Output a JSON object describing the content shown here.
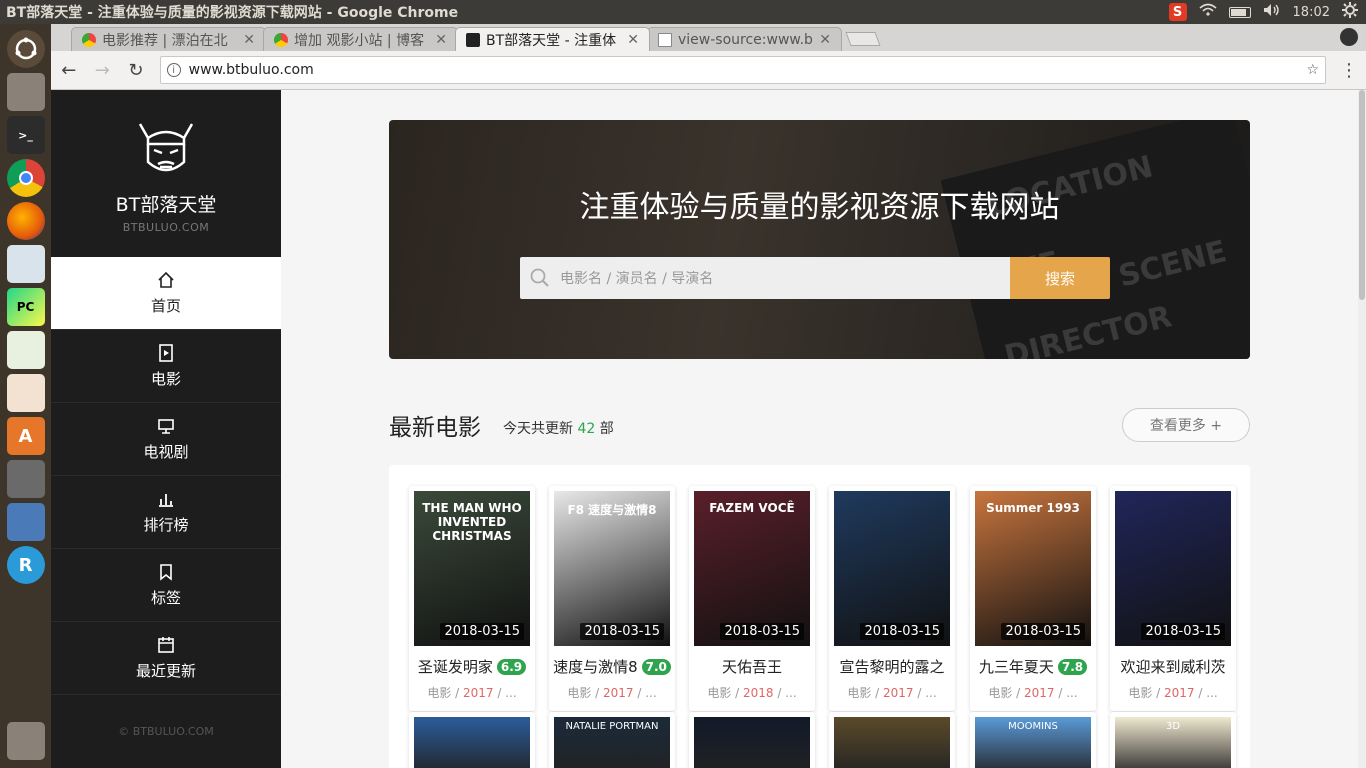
{
  "window_title": "BT部落天堂 - 注重体验与质量的影视资源下载网站 - Google Chrome",
  "tray": {
    "ime": "S",
    "clock": "18:02"
  },
  "tabs": [
    {
      "label": "电影推荐 | 漂泊在北"
    },
    {
      "label": "增加 观影小站 | 博客"
    },
    {
      "label": "BT部落天堂 - 注重体"
    },
    {
      "label": "view-source:www.b"
    }
  ],
  "address": {
    "url": "www.btbuluo.com"
  },
  "site": {
    "name": "BT部落天堂",
    "domain": "BTBULUO.COM",
    "copyright": "© BTBULUO.COM"
  },
  "nav": [
    {
      "label": "首页",
      "icon": "home-icon"
    },
    {
      "label": "电影",
      "icon": "film-icon"
    },
    {
      "label": "电视剧",
      "icon": "tv-icon"
    },
    {
      "label": "排行榜",
      "icon": "chart-icon"
    },
    {
      "label": "标签",
      "icon": "bookmark-icon"
    },
    {
      "label": "最近更新",
      "icon": "calendar-icon"
    }
  ],
  "hero": {
    "heading": "注重体验与质量的影视资源下载网站",
    "search_placeholder": "电影名 / 演员名 / 导演名",
    "search_button": "搜索"
  },
  "latest": {
    "title": "最新电影",
    "count_prefix": "今天共更新",
    "count": "42",
    "count_suffix": "部",
    "more": "查看更多 +"
  },
  "movies": [
    {
      "title": "圣诞发明家",
      "score": "6.9",
      "date": "2018-03-15",
      "genre": "电影",
      "year": "2017",
      "extra": "...",
      "poster_text": "THE MAN WHO INVENTED CHRISTMAS",
      "color": "#3b4a3a"
    },
    {
      "title": "速度与激情8",
      "score": "7.0",
      "date": "2018-03-15",
      "genre": "电影",
      "year": "2017",
      "extra": "...",
      "poster_text": "F8 速度与激情8",
      "color": "#e8e8e8"
    },
    {
      "title": "天佑吾王",
      "score": "",
      "date": "2018-03-15",
      "genre": "电影",
      "year": "2018",
      "extra": "...",
      "poster_text": "FAZEM VOCÊ",
      "color": "#5a1f2a"
    },
    {
      "title": "宣告黎明的露之",
      "score": "",
      "date": "2018-03-15",
      "genre": "电影",
      "year": "2017",
      "extra": "...",
      "poster_text": "",
      "color": "#1f3a5e"
    },
    {
      "title": "九三年夏天",
      "score": "7.8",
      "date": "2018-03-15",
      "genre": "电影",
      "year": "2017",
      "extra": "...",
      "poster_text": "Summer 1993",
      "color": "#c8753e"
    },
    {
      "title": "欢迎来到威利茨",
      "score": "",
      "date": "2018-03-15",
      "genre": "电影",
      "year": "2017",
      "extra": "...",
      "poster_text": "",
      "color": "#20265a"
    }
  ],
  "row2_posters": [
    {
      "text": "",
      "color": "#2a5d9a"
    },
    {
      "text": "NATALIE PORTMAN",
      "color": "#1b2a3a"
    },
    {
      "text": "",
      "color": "#111a2a"
    },
    {
      "text": "",
      "color": "#5a4a2a"
    },
    {
      "text": "MOOMINS",
      "color": "#5a9ad8"
    },
    {
      "text": "3D",
      "color": "#f0e8d0"
    }
  ]
}
